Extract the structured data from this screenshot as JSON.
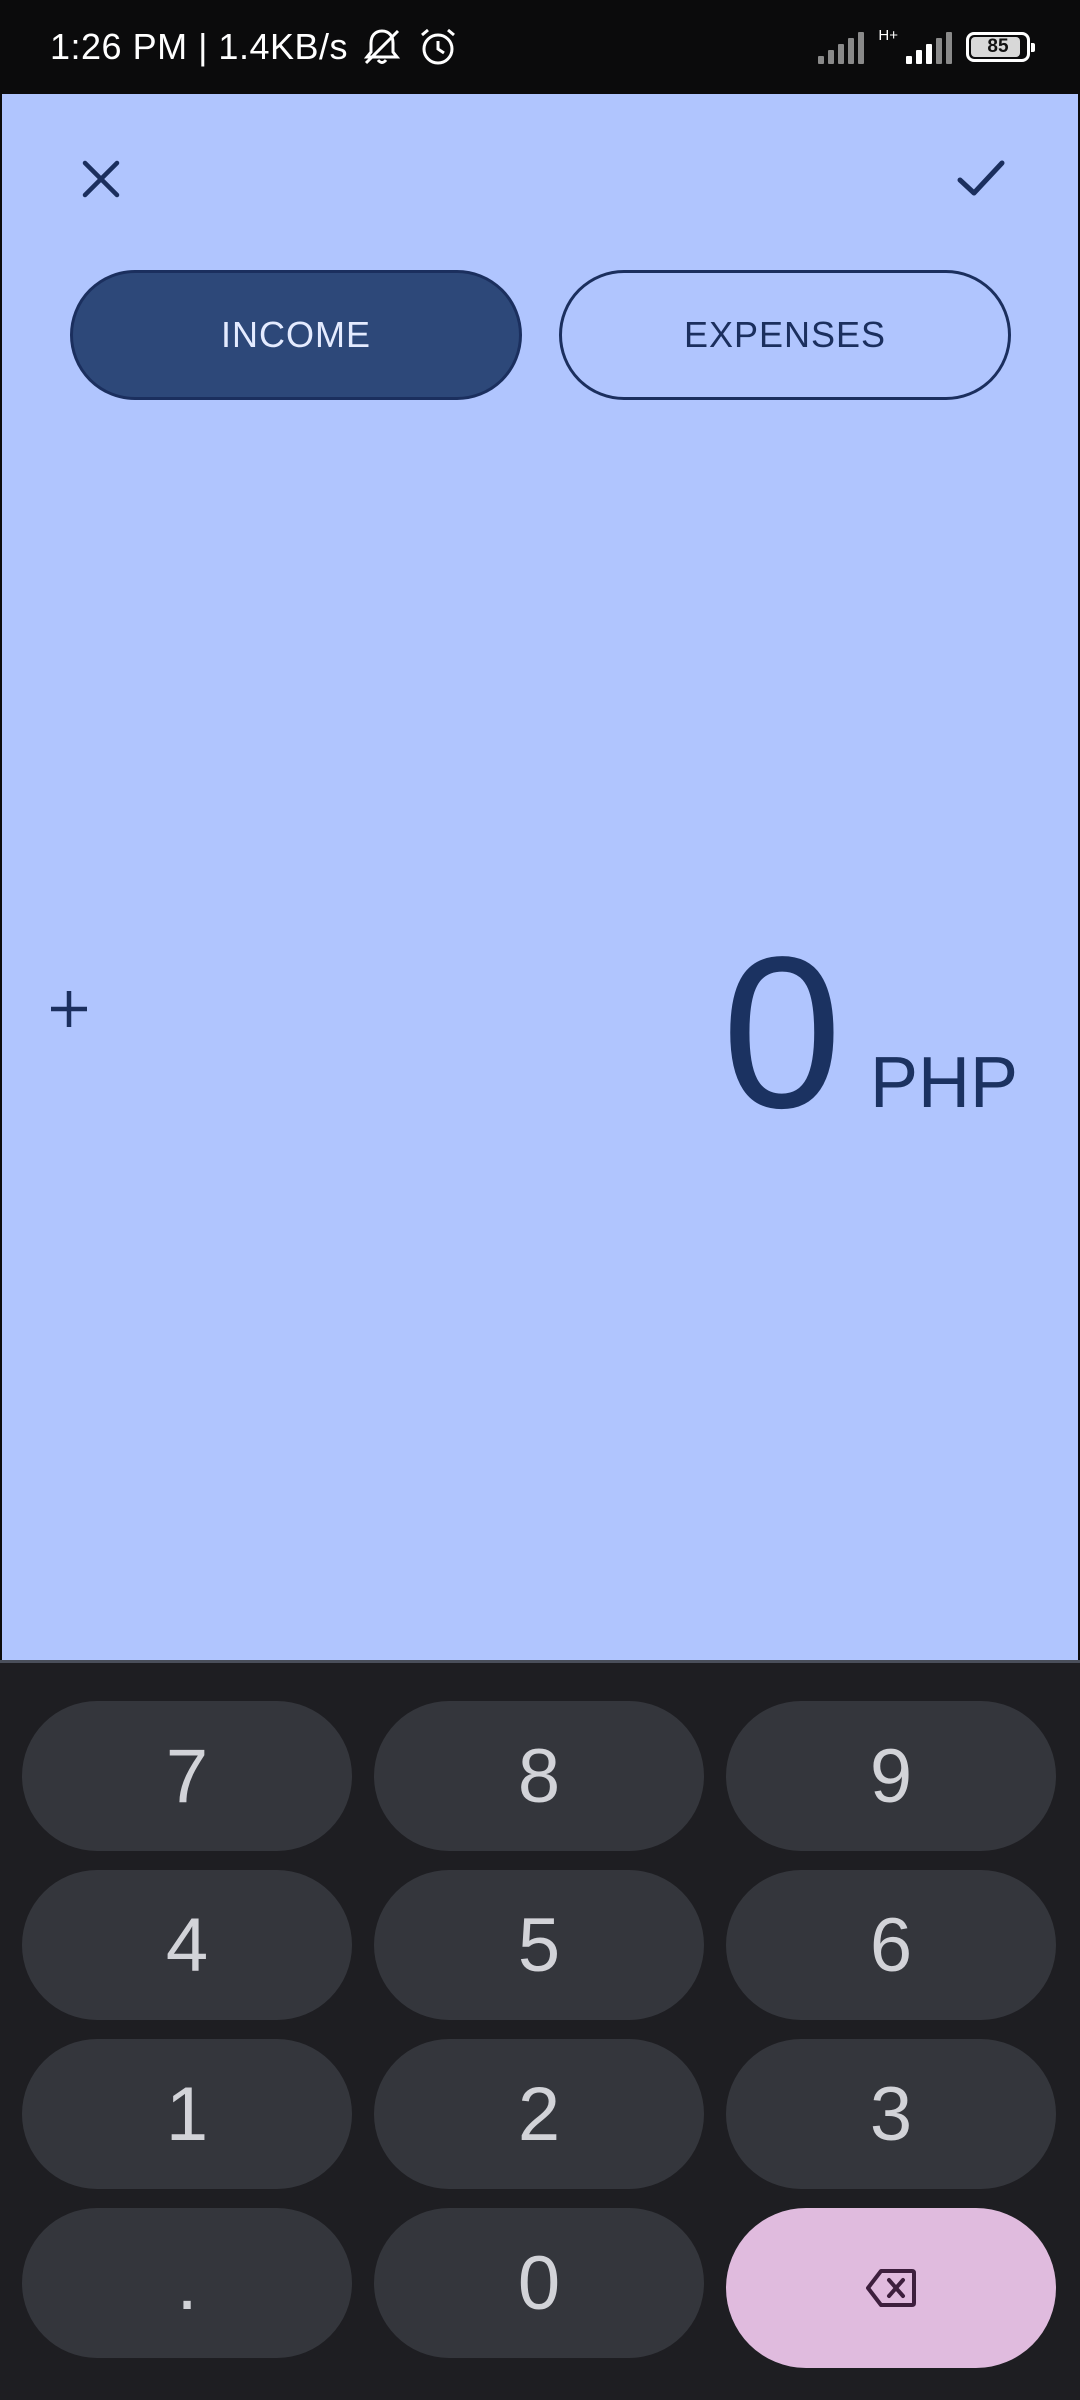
{
  "status_bar": {
    "time_speed": "1:26 PM | 1.4KB/s",
    "network_type": "H+",
    "battery_level": "85",
    "icons": [
      "muted-bell-icon",
      "alarm-icon",
      "signal-icon",
      "battery-icon"
    ]
  },
  "toolbar": {
    "close_icon": "close-icon",
    "confirm_icon": "check-icon"
  },
  "type_toggle": {
    "income_label": "INCOME",
    "expenses_label": "EXPENSES",
    "selected": "INCOME"
  },
  "amount": {
    "value": "0",
    "currency": "PHP",
    "add_icon": "plus-icon"
  },
  "keypad": {
    "keys": [
      "7",
      "8",
      "9",
      "4",
      "5",
      "6",
      "1",
      "2",
      "3",
      ".",
      "0"
    ],
    "backspace_icon": "backspace-icon"
  },
  "colors": {
    "editor_background": "#b0c5fe",
    "accent_dark": "#2d4879",
    "text_dark": "#1b3261",
    "keypad_background": "#1e1e22",
    "key_background": "#34363c",
    "backspace_background": "#e0bbde"
  }
}
